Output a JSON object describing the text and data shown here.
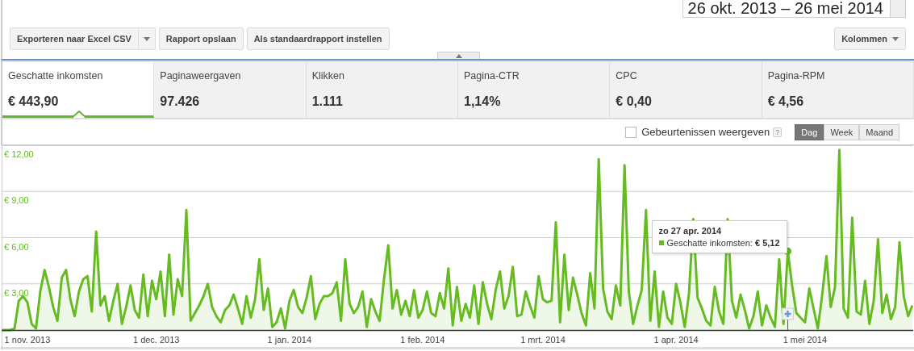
{
  "date_range": {
    "value": "26 okt. 2013 – 26 mei 2014"
  },
  "toolbar": {
    "buttons": [
      {
        "label": "Exporteren naar Excel CSV",
        "dropdown": true
      },
      {
        "label": "Rapport opslaan",
        "dropdown": false
      },
      {
        "label": "Als standaardrapport instellen",
        "dropdown": false
      }
    ],
    "columns_button": {
      "label": "Kolommen"
    }
  },
  "metrics": [
    {
      "label": "Geschatte inkomsten",
      "value": "€ 443,90",
      "selected": true
    },
    {
      "label": "Paginaweergaven",
      "value": "97.426",
      "selected": false
    },
    {
      "label": "Klikken",
      "value": "1.111",
      "selected": false
    },
    {
      "label": "Pagina-CTR",
      "value": "1,14%",
      "selected": false
    },
    {
      "label": "CPC",
      "value": "€ 0,40",
      "selected": false
    },
    {
      "label": "Pagina-RPM",
      "value": "€ 4,56",
      "selected": false
    }
  ],
  "chart_options": {
    "show_events": {
      "label": "Gebeurtenissen weergeven",
      "checked": false,
      "help": "?"
    },
    "granularity": [
      {
        "label": "Dag",
        "selected": true
      },
      {
        "label": "Week",
        "selected": false
      },
      {
        "label": "Maand",
        "selected": false
      }
    ]
  },
  "chart": {
    "tooltip": {
      "title": "zo 27 apr. 2014",
      "text": "Geschatte inkomsten: **€ 5,12**"
    },
    "chart_data": {
      "type": "area",
      "grid": true,
      "ylim": [
        0,
        12
      ],
      "categories": [
        null,
        null,
        null,
        null,
        null,
        null,
        "1 nov. 2013",
        null,
        null,
        null,
        null,
        null,
        null,
        null,
        null,
        null,
        null,
        null,
        null,
        null,
        null,
        null,
        null,
        null,
        null,
        null,
        null,
        null,
        null,
        null,
        null,
        null,
        null,
        null,
        null,
        null,
        "1 dec. 2013",
        null,
        null,
        null,
        null,
        null,
        null,
        null,
        null,
        null,
        null,
        null,
        null,
        null,
        null,
        null,
        null,
        null,
        null,
        null,
        null,
        null,
        null,
        null,
        null,
        null,
        null,
        null,
        null,
        null,
        null,
        "1 jan. 2014",
        null,
        null,
        null,
        null,
        null,
        null,
        null,
        null,
        null,
        null,
        null,
        null,
        null,
        null,
        null,
        null,
        null,
        null,
        null,
        null,
        null,
        null,
        null,
        null,
        null,
        null,
        null,
        null,
        null,
        null,
        "1 feb. 2014",
        null,
        null,
        null,
        null,
        null,
        null,
        null,
        null,
        null,
        null,
        null,
        null,
        null,
        null,
        null,
        null,
        null,
        null,
        null,
        null,
        null,
        null,
        null,
        null,
        null,
        null,
        null,
        "1 mrt. 2014",
        null,
        null,
        null,
        null,
        null,
        null,
        null,
        null,
        null,
        null,
        null,
        null,
        null,
        null,
        null,
        null,
        null,
        null,
        null,
        null,
        null,
        null,
        null,
        null,
        null,
        null,
        null,
        null,
        null,
        null,
        "1 apr. 2014",
        null,
        null,
        null,
        null,
        null,
        null,
        null,
        null,
        null,
        null,
        null,
        null,
        null,
        null,
        null,
        null,
        null,
        null,
        null,
        null,
        null,
        null,
        null,
        null,
        null,
        null,
        null,
        null,
        null,
        "1 mei 2014",
        null,
        null,
        null,
        null,
        null,
        null,
        null,
        null,
        null,
        null,
        null,
        null,
        null,
        null,
        null,
        null,
        null,
        null,
        null,
        null,
        null,
        null,
        null,
        null,
        null
      ],
      "yticks": [
        {
          "value": 3,
          "label": "€ 3,00"
        },
        {
          "value": 6,
          "label": "€ 6,00"
        },
        {
          "value": 9,
          "label": "€ 9,00"
        },
        {
          "value": 12,
          "label": "€ 12,00"
        }
      ],
      "series": [
        {
          "color": "#66bb22",
          "values": [
            0,
            0,
            0,
            0.1,
            1.9,
            2.2,
            1.8,
            0.4,
            0.1,
            2.5,
            3.9,
            2.8,
            1.5,
            0.6,
            3.4,
            3.9,
            2.0,
            0.9,
            2.5,
            3.3,
            3.5,
            1.2,
            6.4,
            1.6,
            2.2,
            0.6,
            1.9,
            3.0,
            0.4,
            1.5,
            2.9,
            1.3,
            0.8,
            3.6,
            0.9,
            3.2,
            2.0,
            3.8,
            0.9,
            4.9,
            1.0,
            3.3,
            2.2,
            7.8,
            0.6,
            1.1,
            1.6,
            2.2,
            3.0,
            1.5,
            0.9,
            0.5,
            1.3,
            1.6,
            2.3,
            1.4,
            0.4,
            2.2,
            0.8,
            2.0,
            4.6,
            1.3,
            2.7,
            0.2,
            0.5,
            1.4,
            0.1,
            1.9,
            2.6,
            1.5,
            1.1,
            2.1,
            3.5,
            0.7,
            1.7,
            2.2,
            2.2,
            2.4,
            3.1,
            0.6,
            4.6,
            1.7,
            1.1,
            1.5,
            2.5,
            0.2,
            2.0,
            1.2,
            0.6,
            3.3,
            5.5,
            1.4,
            2.6,
            1.0,
            1.9,
            0.9,
            2.6,
            0.8,
            1.3,
            2.5,
            1.1,
            0.9,
            2.4,
            1.4,
            4.0,
            0.3,
            2.8,
            0.6,
            1.7,
            0.8,
            2.9,
            0.4,
            3.1,
            1.7,
            0.7,
            2.6,
            3.8,
            1.4,
            2.2,
            4.1,
            0.9,
            1.0,
            2.5,
            1.6,
            0.8,
            3.5,
            2.0,
            1.8,
            1.9,
            7.0,
            0.5,
            4.9,
            1.3,
            3.4,
            2.3,
            1.1,
            0.3,
            3.7,
            1.4,
            11.1,
            2.7,
            1.2,
            0.7,
            2.9,
            1.6,
            10.7,
            2.5,
            0.4,
            1.6,
            2.6,
            7.8,
            0.6,
            3.8,
            0.2,
            2.5,
            0.8,
            0.4,
            3.0,
            1.8,
            0.2,
            2.4,
            7.2,
            2.1,
            1.4,
            0.6,
            0.3,
            2.8,
            1.2,
            0.4,
            7.2,
            1.9,
            0.8,
            2.3,
            1.3,
            0.1,
            0.9,
            2.5,
            0.3,
            1.6,
            0.8,
            0.2,
            4.6,
            0.4,
            5.12,
            2.9,
            1.1,
            0.8,
            0.5,
            2.7,
            1.4,
            0.1,
            2.3,
            4.8,
            1.5,
            2.8,
            11.7,
            1.4,
            0.8,
            7.3,
            1.2,
            1.0,
            3.2,
            0.4,
            1.9,
            5.9,
            1.1,
            2.3,
            0.7,
            1.5,
            5.7,
            2.2,
            0.9,
            1.6
          ]
        }
      ]
    }
  }
}
